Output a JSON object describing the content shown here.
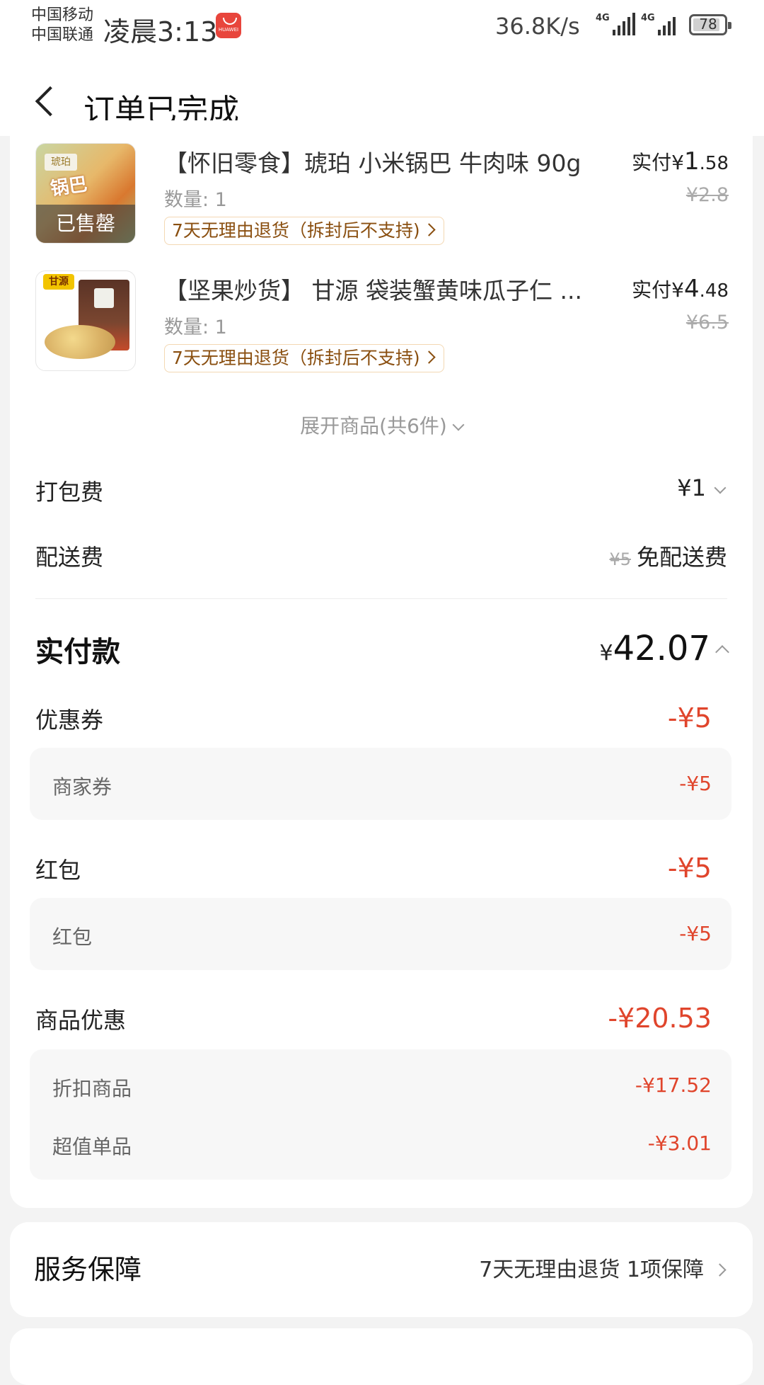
{
  "status_bar": {
    "carrier1": "中国移动",
    "carrier2": "中国联通",
    "time": "凌晨3:13",
    "app_badge": "HUAWEI",
    "net_speed": "36.8K/s",
    "signal_tag1": "4G",
    "signal_tag2": "4G",
    "battery": "78"
  },
  "header": {
    "title": "订单已完成"
  },
  "products": [
    {
      "title": "【怀旧零食】琥珀 小米锅巴 牛肉味 90g",
      "pay_prefix": "实付",
      "pay_yen": "¥",
      "pay_int": "1",
      "pay_dec": ".58",
      "qty": "数量: 1",
      "orig_price": "¥2.8",
      "tag": "7天无理由退货（拆封后不支持)",
      "soldout": "已售罄",
      "pkg_label": "琥珀",
      "pkg_text": "锅巴"
    },
    {
      "title": "【坚果炒货】 甘源 袋装蟹黄味瓜子仁 ...",
      "pay_prefix": "实付",
      "pay_yen": "¥",
      "pay_int": "4",
      "pay_dec": ".48",
      "qty": "数量: 1",
      "orig_price": "¥6.5",
      "tag": "7天无理由退货（拆封后不支持)",
      "logo": "甘源"
    }
  ],
  "expand": {
    "label": "展开商品(共6件)"
  },
  "fees": {
    "packing_label": "打包费",
    "packing_value": "¥1",
    "delivery_label": "配送费",
    "delivery_orig": "¥5",
    "delivery_value": "免配送费"
  },
  "total": {
    "label": "实付款",
    "yen": "¥",
    "value": "42.07"
  },
  "discounts": {
    "coupon_label": "优惠券",
    "coupon_value": "-¥5",
    "coupon_sub_label": "商家券",
    "coupon_sub_value": "-¥5",
    "redpacket_label": "红包",
    "redpacket_value": "-¥5",
    "redpacket_sub_label": "红包",
    "redpacket_sub_value": "-¥5",
    "goods_label": "商品优惠",
    "goods_value": "-¥20.53",
    "goods_sub1_label": "折扣商品",
    "goods_sub1_value": "-¥17.52",
    "goods_sub2_label": "超值单品",
    "goods_sub2_value": "-¥3.01"
  },
  "service": {
    "title": "服务保障",
    "value": "7天无理由退货 1项保障"
  },
  "colors": {
    "accent_red": "#e0452c",
    "tag_border": "#f3d8b3"
  }
}
